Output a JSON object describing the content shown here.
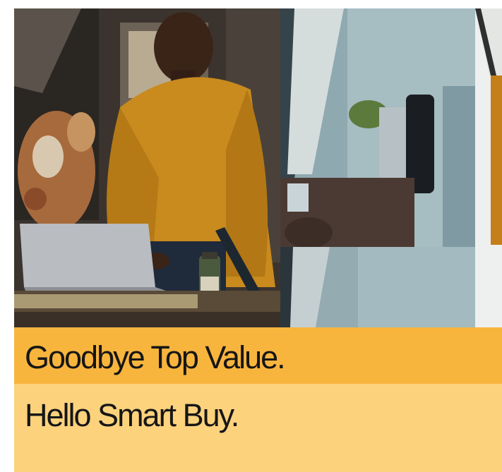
{
  "headline": {
    "line1": "Goodbye Top Value.",
    "line2": "Hello Smart Buy."
  },
  "colors": {
    "band_top": "#f8b53e",
    "band_bottom": "#fcd27d",
    "text": "#161616",
    "sweater": "#c98a1e"
  }
}
